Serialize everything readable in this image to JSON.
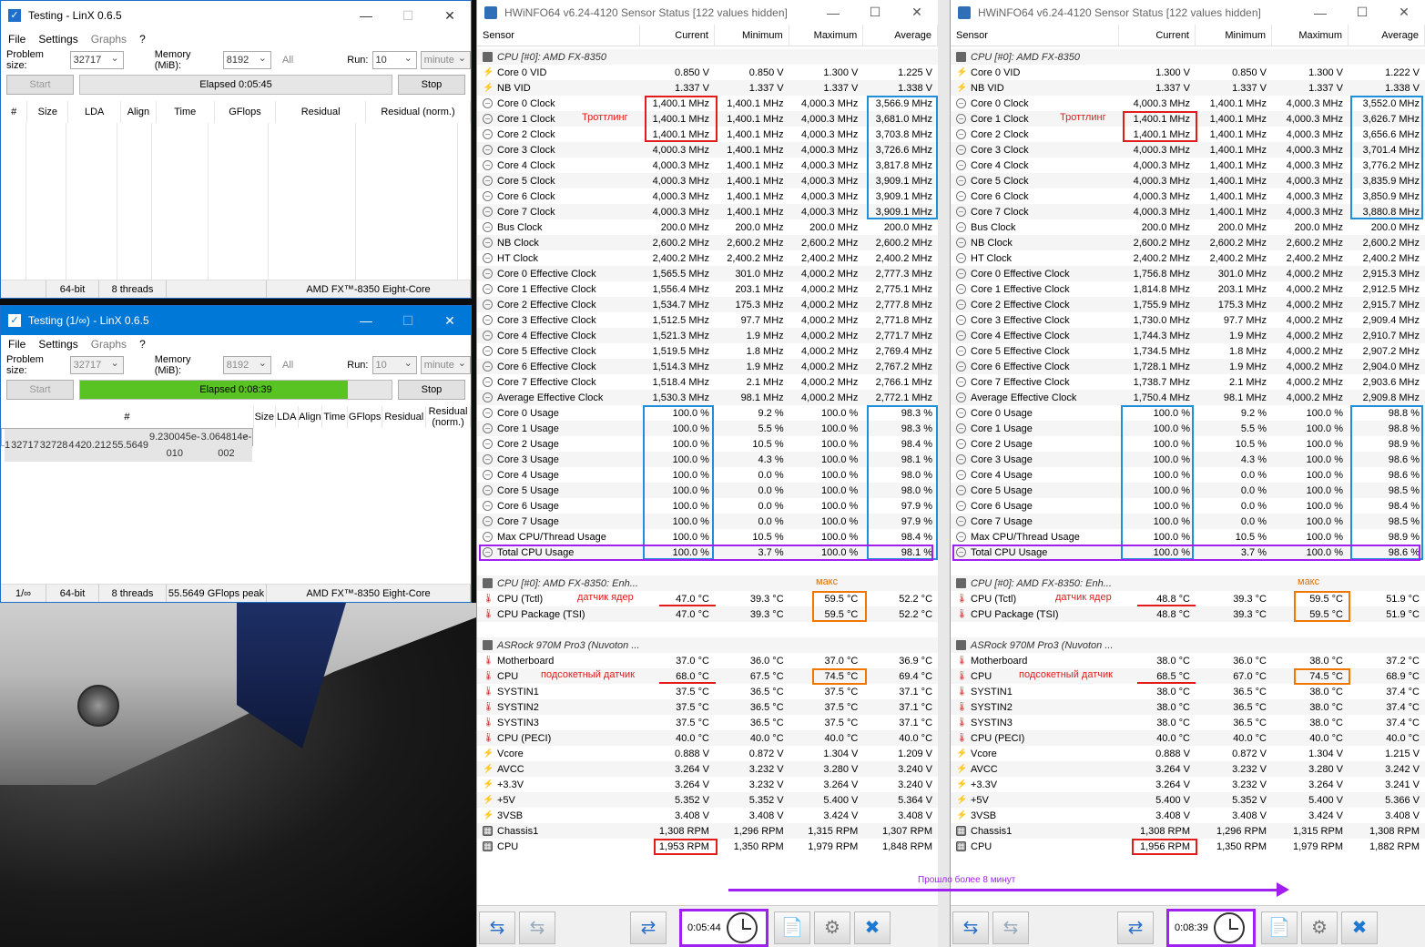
{
  "linx1": {
    "title": "Testing - LinX 0.6.5",
    "menu": [
      "File",
      "Settings",
      "Graphs",
      "?"
    ],
    "problem_label": "Problem size:",
    "problem_value": "32717",
    "memory_label": "Memory (MiB):",
    "memory_value": "8192",
    "all_label": "All",
    "run_label": "Run:",
    "run_value": "10",
    "run_unit": "minute",
    "start": "Start",
    "elapsed": "Elapsed 0:05:45",
    "stop": "Stop",
    "columns": [
      "#",
      "Size",
      "LDA",
      "Align",
      "Time",
      "GFlops",
      "Residual",
      "Residual (norm.)"
    ],
    "status": [
      "",
      "64-bit",
      "8 threads",
      "",
      "AMD FX™-8350 Eight-Core"
    ]
  },
  "linx2": {
    "title": "Testing (1/∞) - LinX 0.6.5",
    "menu": [
      "File",
      "Settings",
      "Graphs",
      "?"
    ],
    "problem_label": "Problem size:",
    "problem_value": "32717",
    "memory_label": "Memory (MiB):",
    "memory_value": "8192",
    "all_label": "All",
    "run_label": "Run:",
    "run_value": "10",
    "run_unit": "minute",
    "start": "Start",
    "elapsed": "Elapsed 0:08:39",
    "progress": 0.86,
    "stop": "Stop",
    "columns": [
      "#",
      "Size",
      "LDA",
      "Align",
      "Time",
      "GFlops",
      "Residual",
      "Residual (norm.)"
    ],
    "rows": [
      [
        "1",
        "32717",
        "32728",
        "4",
        "420.212",
        "55.5649",
        "9.230045e-010",
        "3.064814e-002"
      ]
    ],
    "status": [
      "1/∞",
      "64-bit",
      "8 threads",
      "55.5649 GFlops peak",
      "AMD FX™-8350 Eight-Core"
    ]
  },
  "hw_title": "HWiNFO64 v6.24-4120 Sensor Status [122 values hidden]",
  "hw_columns": [
    "Sensor",
    "Current",
    "Minimum",
    "Maximum",
    "Average"
  ],
  "hw_names": [
    [
      "g",
      "CPU [#0]: AMD FX-8350"
    ],
    [
      "v",
      "Core 0 VID"
    ],
    [
      "v",
      "NB VID"
    ],
    [
      "c",
      "Core 0 Clock"
    ],
    [
      "c",
      "Core 1 Clock"
    ],
    [
      "c",
      "Core 2 Clock"
    ],
    [
      "c",
      "Core 3 Clock"
    ],
    [
      "c",
      "Core 4 Clock"
    ],
    [
      "c",
      "Core 5 Clock"
    ],
    [
      "c",
      "Core 6 Clock"
    ],
    [
      "c",
      "Core 7 Clock"
    ],
    [
      "c",
      "Bus Clock"
    ],
    [
      "c",
      "NB Clock"
    ],
    [
      "c",
      "HT Clock"
    ],
    [
      "c",
      "Core 0 Effective Clock"
    ],
    [
      "c",
      "Core 1 Effective Clock"
    ],
    [
      "c",
      "Core 2 Effective Clock"
    ],
    [
      "c",
      "Core 3 Effective Clock"
    ],
    [
      "c",
      "Core 4 Effective Clock"
    ],
    [
      "c",
      "Core 5 Effective Clock"
    ],
    [
      "c",
      "Core 6 Effective Clock"
    ],
    [
      "c",
      "Core 7 Effective Clock"
    ],
    [
      "c",
      "Average Effective Clock"
    ],
    [
      "c",
      "Core 0 Usage"
    ],
    [
      "c",
      "Core 1 Usage"
    ],
    [
      "c",
      "Core 2 Usage"
    ],
    [
      "c",
      "Core 3 Usage"
    ],
    [
      "c",
      "Core 4 Usage"
    ],
    [
      "c",
      "Core 5 Usage"
    ],
    [
      "c",
      "Core 6 Usage"
    ],
    [
      "c",
      "Core 7 Usage"
    ],
    [
      "c",
      "Max CPU/Thread Usage"
    ],
    [
      "c",
      "Total CPU Usage"
    ],
    [
      "e",
      ""
    ],
    [
      "g",
      "CPU [#0]: AMD FX-8350: Enh..."
    ],
    [
      "t",
      "CPU (Tctl)"
    ],
    [
      "t",
      "CPU Package (TSI)"
    ],
    [
      "e",
      ""
    ],
    [
      "g",
      "ASRock 970M Pro3 (Nuvoton ..."
    ],
    [
      "t",
      "Motherboard"
    ],
    [
      "t",
      "CPU"
    ],
    [
      "t",
      "SYSTIN1"
    ],
    [
      "t",
      "SYSTIN2"
    ],
    [
      "t",
      "SYSTIN3"
    ],
    [
      "t",
      "CPU (PECI)"
    ],
    [
      "v",
      "Vcore"
    ],
    [
      "v",
      "AVCC"
    ],
    [
      "v",
      "+3.3V"
    ],
    [
      "v",
      "+5V"
    ],
    [
      "v",
      "3VSB"
    ],
    [
      "f",
      "Chassis1"
    ],
    [
      "f",
      "CPU"
    ]
  ],
  "hw1": {
    "values": [
      [
        "",
        "",
        "",
        ""
      ],
      [
        "0.850 V",
        "0.850 V",
        "1.300 V",
        "1.225 V"
      ],
      [
        "1.337 V",
        "1.337 V",
        "1.337 V",
        "1.338 V"
      ],
      [
        "1,400.1 MHz",
        "1,400.1 MHz",
        "4,000.3 MHz",
        "3,566.9 MHz"
      ],
      [
        "1,400.1 MHz",
        "1,400.1 MHz",
        "4,000.3 MHz",
        "3,681.0 MHz"
      ],
      [
        "1,400.1 MHz",
        "1,400.1 MHz",
        "4,000.3 MHz",
        "3,703.8 MHz"
      ],
      [
        "4,000.3 MHz",
        "1,400.1 MHz",
        "4,000.3 MHz",
        "3,726.6 MHz"
      ],
      [
        "4,000.3 MHz",
        "1,400.1 MHz",
        "4,000.3 MHz",
        "3,817.8 MHz"
      ],
      [
        "4,000.3 MHz",
        "1,400.1 MHz",
        "4,000.3 MHz",
        "3,909.1 MHz"
      ],
      [
        "4,000.3 MHz",
        "1,400.1 MHz",
        "4,000.3 MHz",
        "3,909.1 MHz"
      ],
      [
        "4,000.3 MHz",
        "1,400.1 MHz",
        "4,000.3 MHz",
        "3,909.1 MHz"
      ],
      [
        "200.0 MHz",
        "200.0 MHz",
        "200.0 MHz",
        "200.0 MHz"
      ],
      [
        "2,600.2 MHz",
        "2,600.2 MHz",
        "2,600.2 MHz",
        "2,600.2 MHz"
      ],
      [
        "2,400.2 MHz",
        "2,400.2 MHz",
        "2,400.2 MHz",
        "2,400.2 MHz"
      ],
      [
        "1,565.5 MHz",
        "301.0 MHz",
        "4,000.2 MHz",
        "2,777.3 MHz"
      ],
      [
        "1,556.4 MHz",
        "203.1 MHz",
        "4,000.2 MHz",
        "2,775.1 MHz"
      ],
      [
        "1,534.7 MHz",
        "175.3 MHz",
        "4,000.2 MHz",
        "2,777.8 MHz"
      ],
      [
        "1,512.5 MHz",
        "97.7 MHz",
        "4,000.2 MHz",
        "2,771.8 MHz"
      ],
      [
        "1,521.3 MHz",
        "1.9 MHz",
        "4,000.2 MHz",
        "2,771.7 MHz"
      ],
      [
        "1,519.5 MHz",
        "1.8 MHz",
        "4,000.2 MHz",
        "2,769.4 MHz"
      ],
      [
        "1,514.3 MHz",
        "1.9 MHz",
        "4,000.2 MHz",
        "2,767.2 MHz"
      ],
      [
        "1,518.4 MHz",
        "2.1 MHz",
        "4,000.2 MHz",
        "2,766.1 MHz"
      ],
      [
        "1,530.3 MHz",
        "98.1 MHz",
        "4,000.2 MHz",
        "2,772.1 MHz"
      ],
      [
        "100.0 %",
        "9.2 %",
        "100.0 %",
        "98.3 %"
      ],
      [
        "100.0 %",
        "5.5 %",
        "100.0 %",
        "98.3 %"
      ],
      [
        "100.0 %",
        "10.5 %",
        "100.0 %",
        "98.4 %"
      ],
      [
        "100.0 %",
        "4.3 %",
        "100.0 %",
        "98.1 %"
      ],
      [
        "100.0 %",
        "0.0 %",
        "100.0 %",
        "98.0 %"
      ],
      [
        "100.0 %",
        "0.0 %",
        "100.0 %",
        "98.0 %"
      ],
      [
        "100.0 %",
        "0.0 %",
        "100.0 %",
        "97.9 %"
      ],
      [
        "100.0 %",
        "0.0 %",
        "100.0 %",
        "97.9 %"
      ],
      [
        "100.0 %",
        "10.5 %",
        "100.0 %",
        "98.4 %"
      ],
      [
        "100.0 %",
        "3.7 %",
        "100.0 %",
        "98.1 %"
      ],
      [
        "",
        "",
        "",
        ""
      ],
      [
        "",
        "",
        "",
        ""
      ],
      [
        "47.0 °C",
        "39.3 °C",
        "59.5 °C",
        "52.2 °C"
      ],
      [
        "47.0 °C",
        "39.3 °C",
        "59.5 °C",
        "52.2 °C"
      ],
      [
        "",
        "",
        "",
        ""
      ],
      [
        "",
        "",
        "",
        ""
      ],
      [
        "37.0 °C",
        "36.0 °C",
        "37.0 °C",
        "36.9 °C"
      ],
      [
        "68.0 °C",
        "67.5 °C",
        "74.5 °C",
        "69.4 °C"
      ],
      [
        "37.5 °C",
        "36.5 °C",
        "37.5 °C",
        "37.1 °C"
      ],
      [
        "37.5 °C",
        "36.5 °C",
        "37.5 °C",
        "37.1 °C"
      ],
      [
        "37.5 °C",
        "36.5 °C",
        "37.5 °C",
        "37.1 °C"
      ],
      [
        "40.0 °C",
        "40.0 °C",
        "40.0 °C",
        "40.0 °C"
      ],
      [
        "0.888 V",
        "0.872 V",
        "1.304 V",
        "1.209 V"
      ],
      [
        "3.264 V",
        "3.232 V",
        "3.280 V",
        "3.240 V"
      ],
      [
        "3.264 V",
        "3.232 V",
        "3.264 V",
        "3.240 V"
      ],
      [
        "5.352 V",
        "5.352 V",
        "5.400 V",
        "5.364 V"
      ],
      [
        "3.408 V",
        "3.408 V",
        "3.424 V",
        "3.408 V"
      ],
      [
        "1,308 RPM",
        "1,296 RPM",
        "1,315 RPM",
        "1,307 RPM"
      ],
      [
        "1,953 RPM",
        "1,350 RPM",
        "1,979 RPM",
        "1,848 RPM"
      ]
    ],
    "timer": "0:05:44"
  },
  "hw2": {
    "values": [
      [
        "",
        "",
        "",
        ""
      ],
      [
        "1.300 V",
        "0.850 V",
        "1.300 V",
        "1.222 V"
      ],
      [
        "1.337 V",
        "1.337 V",
        "1.337 V",
        "1.338 V"
      ],
      [
        "4,000.3 MHz",
        "1,400.1 MHz",
        "4,000.3 MHz",
        "3,552.0 MHz"
      ],
      [
        "1,400.1 MHz",
        "1,400.1 MHz",
        "4,000.3 MHz",
        "3,626.7 MHz"
      ],
      [
        "1,400.1 MHz",
        "1,400.1 MHz",
        "4,000.3 MHz",
        "3,656.6 MHz"
      ],
      [
        "4,000.3 MHz",
        "1,400.1 MHz",
        "4,000.3 MHz",
        "3,701.4 MHz"
      ],
      [
        "4,000.3 MHz",
        "1,400.1 MHz",
        "4,000.3 MHz",
        "3,776.2 MHz"
      ],
      [
        "4,000.3 MHz",
        "1,400.1 MHz",
        "4,000.3 MHz",
        "3,835.9 MHz"
      ],
      [
        "4,000.3 MHz",
        "1,400.1 MHz",
        "4,000.3 MHz",
        "3,850.9 MHz"
      ],
      [
        "4,000.3 MHz",
        "1,400.1 MHz",
        "4,000.3 MHz",
        "3,880.8 MHz"
      ],
      [
        "200.0 MHz",
        "200.0 MHz",
        "200.0 MHz",
        "200.0 MHz"
      ],
      [
        "2,600.2 MHz",
        "2,600.2 MHz",
        "2,600.2 MHz",
        "2,600.2 MHz"
      ],
      [
        "2,400.2 MHz",
        "2,400.2 MHz",
        "2,400.2 MHz",
        "2,400.2 MHz"
      ],
      [
        "1,756.8 MHz",
        "301.0 MHz",
        "4,000.2 MHz",
        "2,915.3 MHz"
      ],
      [
        "1,814.8 MHz",
        "203.1 MHz",
        "4,000.2 MHz",
        "2,912.5 MHz"
      ],
      [
        "1,755.9 MHz",
        "175.3 MHz",
        "4,000.2 MHz",
        "2,915.7 MHz"
      ],
      [
        "1,730.0 MHz",
        "97.7 MHz",
        "4,000.2 MHz",
        "2,909.4 MHz"
      ],
      [
        "1,744.3 MHz",
        "1.9 MHz",
        "4,000.2 MHz",
        "2,910.7 MHz"
      ],
      [
        "1,734.5 MHz",
        "1.8 MHz",
        "4,000.2 MHz",
        "2,907.2 MHz"
      ],
      [
        "1,728.1 MHz",
        "1.9 MHz",
        "4,000.2 MHz",
        "2,904.0 MHz"
      ],
      [
        "1,738.7 MHz",
        "2.1 MHz",
        "4,000.2 MHz",
        "2,903.6 MHz"
      ],
      [
        "1,750.4 MHz",
        "98.1 MHz",
        "4,000.2 MHz",
        "2,909.8 MHz"
      ],
      [
        "100.0 %",
        "9.2 %",
        "100.0 %",
        "98.8 %"
      ],
      [
        "100.0 %",
        "5.5 %",
        "100.0 %",
        "98.8 %"
      ],
      [
        "100.0 %",
        "10.5 %",
        "100.0 %",
        "98.9 %"
      ],
      [
        "100.0 %",
        "4.3 %",
        "100.0 %",
        "98.6 %"
      ],
      [
        "100.0 %",
        "0.0 %",
        "100.0 %",
        "98.6 %"
      ],
      [
        "100.0 %",
        "0.0 %",
        "100.0 %",
        "98.5 %"
      ],
      [
        "100.0 %",
        "0.0 %",
        "100.0 %",
        "98.4 %"
      ],
      [
        "100.0 %",
        "0.0 %",
        "100.0 %",
        "98.5 %"
      ],
      [
        "100.0 %",
        "10.5 %",
        "100.0 %",
        "98.9 %"
      ],
      [
        "100.0 %",
        "3.7 %",
        "100.0 %",
        "98.6 %"
      ],
      [
        "",
        "",
        "",
        ""
      ],
      [
        "",
        "",
        "",
        ""
      ],
      [
        "48.8 °C",
        "39.3 °C",
        "59.5 °C",
        "51.9 °C"
      ],
      [
        "48.8 °C",
        "39.3 °C",
        "59.5 °C",
        "51.9 °C"
      ],
      [
        "",
        "",
        "",
        ""
      ],
      [
        "",
        "",
        "",
        ""
      ],
      [
        "38.0 °C",
        "36.0 °C",
        "38.0 °C",
        "37.2 °C"
      ],
      [
        "68.5 °C",
        "67.0 °C",
        "74.5 °C",
        "68.9 °C"
      ],
      [
        "38.0 °C",
        "36.5 °C",
        "38.0 °C",
        "37.4 °C"
      ],
      [
        "38.0 °C",
        "36.5 °C",
        "38.0 °C",
        "37.4 °C"
      ],
      [
        "38.0 °C",
        "36.5 °C",
        "38.0 °C",
        "37.4 °C"
      ],
      [
        "40.0 °C",
        "40.0 °C",
        "40.0 °C",
        "40.0 °C"
      ],
      [
        "0.888 V",
        "0.872 V",
        "1.304 V",
        "1.215 V"
      ],
      [
        "3.264 V",
        "3.232 V",
        "3.280 V",
        "3.242 V"
      ],
      [
        "3.264 V",
        "3.232 V",
        "3.264 V",
        "3.241 V"
      ],
      [
        "5.400 V",
        "5.352 V",
        "5.400 V",
        "5.366 V"
      ],
      [
        "3.408 V",
        "3.408 V",
        "3.424 V",
        "3.408 V"
      ],
      [
        "1,308 RPM",
        "1,296 RPM",
        "1,315 RPM",
        "1,308 RPM"
      ],
      [
        "1,956 RPM",
        "1,350 RPM",
        "1,979 RPM",
        "1,882 RPM"
      ]
    ],
    "timer": "0:08:39"
  },
  "annotations": {
    "throttling": "Троттлинг",
    "max": "макс",
    "core_sensor": "датчик ядер",
    "socket_sensor": "подсокетный датчик",
    "elapsed_note": "Прошло более 8 минут"
  },
  "colors": {
    "red": "#e21b1b",
    "blue": "#1e8fd8",
    "purple": "#a020f0",
    "orange": "#f07800",
    "progress": "#58c322"
  }
}
